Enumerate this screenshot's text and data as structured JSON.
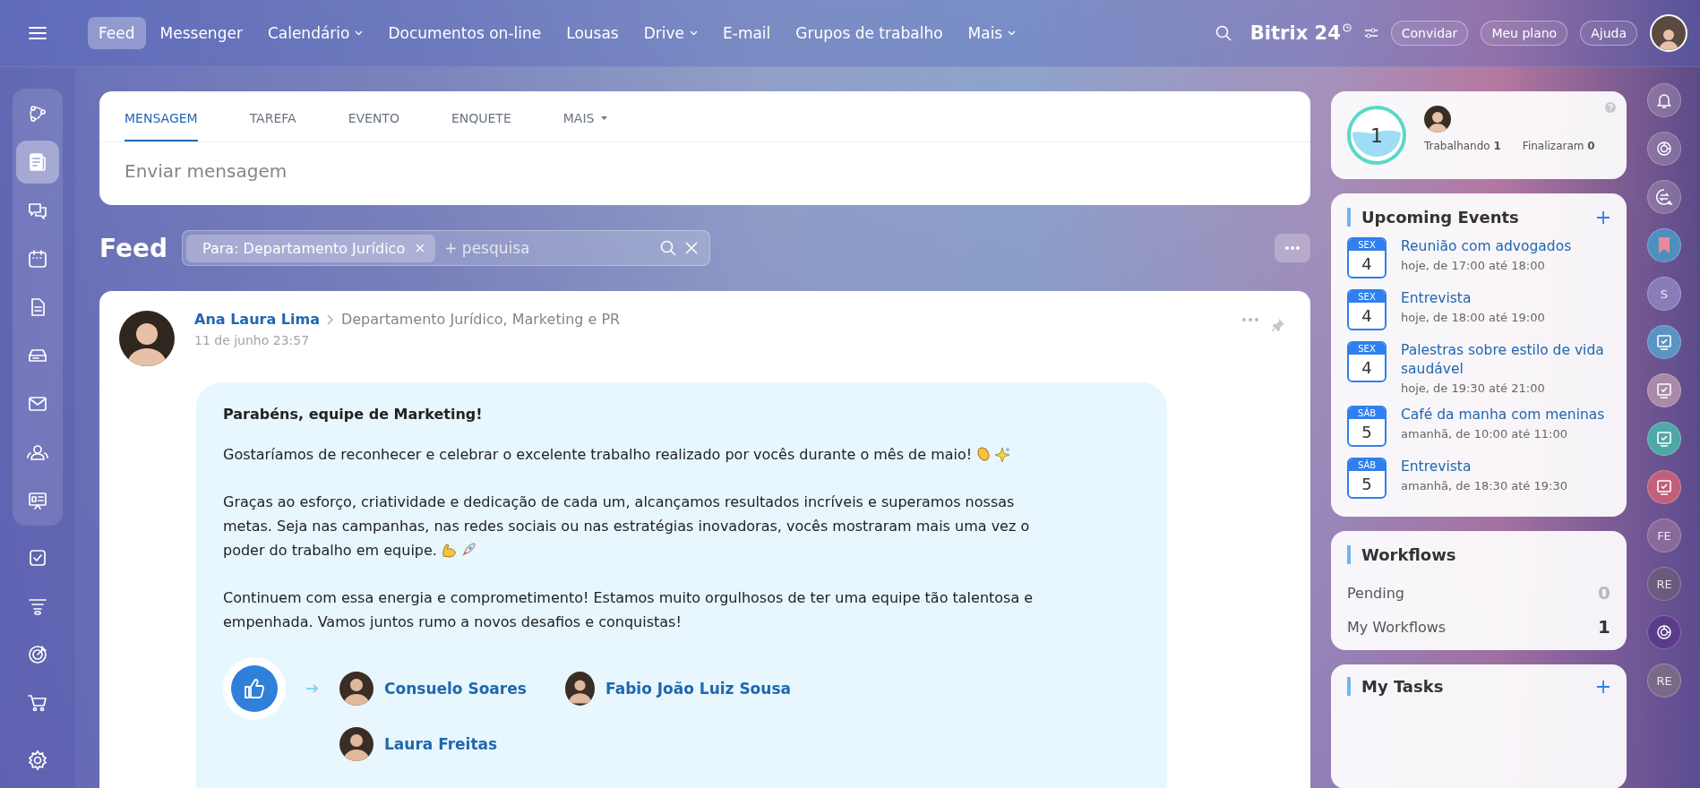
{
  "nav": {
    "items": [
      {
        "label": "Feed",
        "selected": true,
        "dropdown": false
      },
      {
        "label": "Messenger",
        "selected": false,
        "dropdown": false
      },
      {
        "label": "Calendário",
        "selected": false,
        "dropdown": true
      },
      {
        "label": "Documentos on-line",
        "selected": false,
        "dropdown": false
      },
      {
        "label": "Lousas",
        "selected": false,
        "dropdown": false
      },
      {
        "label": "Drive",
        "selected": false,
        "dropdown": true
      },
      {
        "label": "E-mail",
        "selected": false,
        "dropdown": false
      },
      {
        "label": "Grupos de trabalho",
        "selected": false,
        "dropdown": false
      },
      {
        "label": "Mais",
        "selected": false,
        "dropdown": true
      }
    ],
    "logo": {
      "name": "Bitrix",
      "number": "24"
    },
    "buttons": [
      "Convidar",
      "Meu plano",
      "Ajuda"
    ]
  },
  "sidebar": {
    "panel_items": [
      {
        "kind": "flow",
        "selected": false
      },
      {
        "kind": "feed",
        "selected": true
      },
      {
        "kind": "chat",
        "selected": false
      },
      {
        "kind": "calendar",
        "selected": false
      },
      {
        "kind": "doc",
        "selected": false
      },
      {
        "kind": "drive",
        "selected": false
      },
      {
        "kind": "mail",
        "selected": false
      },
      {
        "kind": "contacts",
        "selected": false
      },
      {
        "kind": "board",
        "selected": false
      }
    ],
    "items": [
      {
        "kind": "task",
        "selected": false
      },
      {
        "kind": "funnel",
        "selected": false
      },
      {
        "kind": "target",
        "selected": false
      },
      {
        "kind": "cart",
        "selected": false
      }
    ]
  },
  "composer": {
    "tabs": [
      {
        "label": "MENSAGEM",
        "selected": true,
        "dropdown": false
      },
      {
        "label": "TAREFA",
        "selected": false,
        "dropdown": false
      },
      {
        "label": "EVENTO",
        "selected": false,
        "dropdown": false
      },
      {
        "label": "ENQUETE",
        "selected": false,
        "dropdown": false
      },
      {
        "label": "MAIS",
        "selected": false,
        "dropdown": true
      }
    ],
    "placeholder": "Enviar mensagem"
  },
  "feed": {
    "title": "Feed",
    "filter": "Para: Departamento Jurídico",
    "search_placeholder": "+ pesquisa"
  },
  "post": {
    "author": "Ana Laura Lima",
    "recipients": "Departamento Jurídico, Marketing e PR",
    "date": "11 de junho 23:57",
    "heading": "Parabéns, equipe de Marketing!",
    "paragraphs": [
      {
        "text": "Gostaríamos de reconhecer e celebrar o excelente trabalho realizado por vocês durante o mês de maio!",
        "kind": "celebration"
      },
      {
        "text": "Graças ao esforço, criatividade e dedicação de cada um, alcançamos resultados incríveis e superamos nossas metas. Seja nas campanhas, nas redes sociais ou nas estratégias inovadoras, vocês mostraram mais uma vez o poder do trabalho em equipe.",
        "kind": "strength"
      },
      {
        "text": "Continuem com essa energia e comprometimento! Estamos muito orgulhosos de ter uma equipe tão talentosa e empenhada. Vamos juntos rumo a novos desafios e conquistas!",
        "kind": "plain"
      }
    ],
    "thanked": [
      "Consuelo Soares",
      "Fabio João Luiz Sousa",
      "Laura Freitas"
    ]
  },
  "worktime": {
    "count": "1",
    "working_label": "Trabalhando",
    "working": "1",
    "finished_label": "Finalizaram",
    "finished": "0"
  },
  "events": {
    "title": "Upcoming Events",
    "items": [
      {
        "weekday": "SEX",
        "day": "4",
        "title": "Reunião com advogados",
        "time": "hoje, de 17:00 até 18:00"
      },
      {
        "weekday": "SEX",
        "day": "4",
        "title": "Entrevista",
        "time": "hoje, de 18:00 até 19:00"
      },
      {
        "weekday": "SEX",
        "day": "4",
        "title": "Palestras sobre estilo de vida saudável",
        "time": "hoje, de 19:30 até 21:00"
      },
      {
        "weekday": "SÁB",
        "day": "5",
        "title": "Café da manha com meninas",
        "time": "amanhã, de 10:00 até 11:00"
      },
      {
        "weekday": "SÁB",
        "day": "5",
        "title": "Entrevista",
        "time": "amanhã, de 18:30 até 19:30"
      }
    ]
  },
  "workflows": {
    "title": "Workflows",
    "rows": [
      {
        "label": "Pending",
        "count": "0",
        "muted": true
      },
      {
        "label": "My Workflows",
        "count": "1",
        "muted": false
      }
    ]
  },
  "tasks": {
    "title": "My Tasks"
  },
  "rightbar": {
    "items": [
      {
        "kind": "bell"
      },
      {
        "kind": "copilot"
      },
      {
        "kind": "sync"
      },
      {
        "kind": "bookmark",
        "color": "#4f8fc0"
      },
      {
        "kind": "letter",
        "text": "S",
        "color": "#8a7cb8"
      },
      {
        "kind": "board",
        "color": "#5a94c4"
      },
      {
        "kind": "board",
        "color": "#a98aa8"
      },
      {
        "kind": "board",
        "color": "#4fa8a8"
      },
      {
        "kind": "board",
        "color": "#c0607a"
      },
      {
        "kind": "letter",
        "text": "FE",
        "color": "#8a6a9a"
      },
      {
        "kind": "letter",
        "text": "RE",
        "color": "#6a5a80"
      },
      {
        "kind": "copilot",
        "color": "#5a3c8a"
      },
      {
        "kind": "letter",
        "text": "RE",
        "color": "#7a6a8a"
      }
    ]
  }
}
